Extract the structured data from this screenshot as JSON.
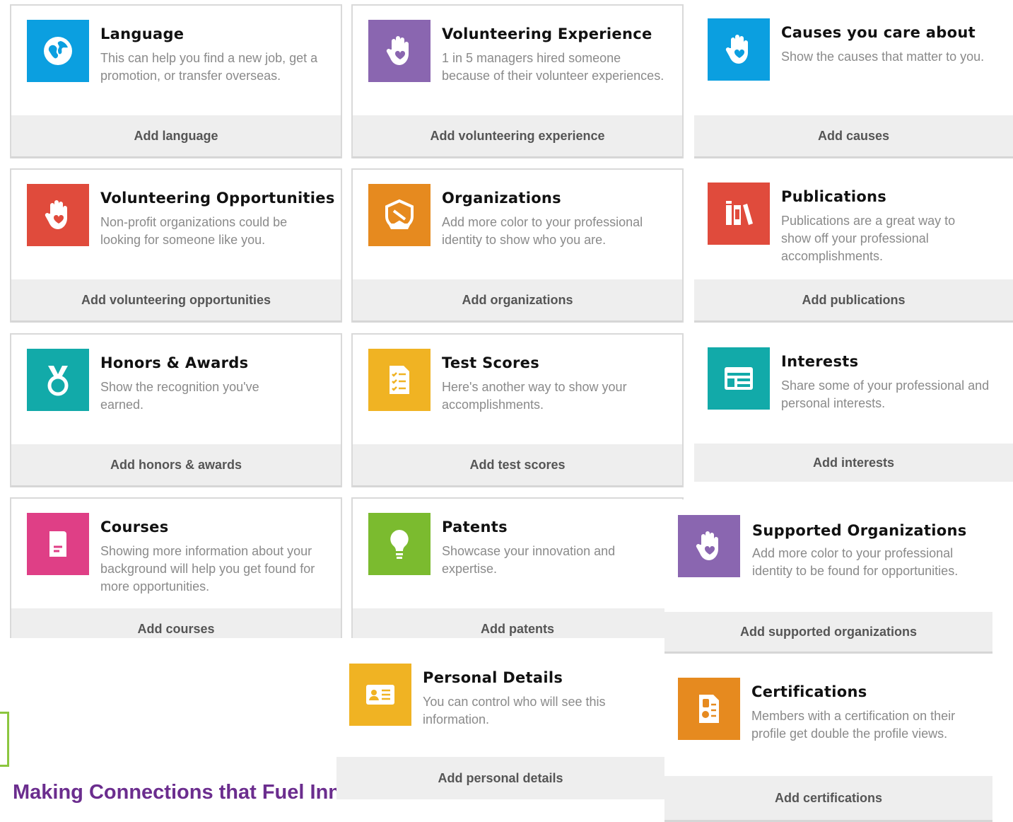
{
  "colors": {
    "blue": "#0b9fe0",
    "purple": "#8a66b0",
    "red": "#e04b3c",
    "orange": "#e68a1f",
    "teal": "#12aaa9",
    "yellow": "#f0b323",
    "pink": "#df3f86",
    "green": "#7bbb2f",
    "footer": "#6b2d8e"
  },
  "cards": {
    "language": {
      "title": "Language",
      "desc": "This can help you find a new job, get a promotion, or transfer overseas.",
      "action": "Add language",
      "icon": "globe-icon"
    },
    "volunteering_experience": {
      "title": "Volunteering Experience",
      "desc": "1 in 5 managers hired someone because of their volunteer experiences.",
      "action": "Add volunteering experience",
      "icon": "heart-hand-icon"
    },
    "causes": {
      "title": "Causes you care about",
      "desc": "Show the causes that matter to you.",
      "action": "Add causes",
      "icon": "heart-hand-icon"
    },
    "volunteering_opportunities": {
      "title": "Volunteering Opportunities",
      "desc": "Non-profit organizations could be looking for someone like you.",
      "action": "Add volunteering opportunities",
      "icon": "heart-hand-icon"
    },
    "organizations": {
      "title": "Organizations",
      "desc": "Add more color to your professional identity to show who you are.",
      "action": "Add organizations",
      "icon": "badge-icon"
    },
    "publications": {
      "title": "Publications",
      "desc": "Publications are a great way to show off your professional accomplishments.",
      "action": "Add publications",
      "icon": "books-icon"
    },
    "honors": {
      "title": "Honors & Awards",
      "desc": "Show the recognition you've earned.",
      "action": "Add honors & awards",
      "icon": "medal-icon"
    },
    "test_scores": {
      "title": "Test Scores",
      "desc": "Here's another way to show your accomplishments.",
      "action": "Add test scores",
      "icon": "checklist-icon"
    },
    "interests": {
      "title": "Interests",
      "desc": "Share some of your professional and personal interests.",
      "action": "Add interests",
      "icon": "browser-icon"
    },
    "courses": {
      "title": "Courses",
      "desc": "Showing more information about your background will help you get found for more opportunities.",
      "action": "Add courses",
      "icon": "book-icon"
    },
    "patents": {
      "title": "Patents",
      "desc": "Showcase your innovation and expertise.",
      "action": "Add patents",
      "icon": "lightbulb-icon"
    },
    "supported_orgs": {
      "title": "Supported Organizations",
      "desc": "Add more color to your professional identity to be found for opportunities.",
      "action": "Add supported organizations",
      "icon": "heart-hand-icon"
    },
    "personal_details": {
      "title": "Personal Details",
      "desc": "You can control who will see this information.",
      "action": "Add personal details",
      "icon": "id-card-icon"
    },
    "certifications": {
      "title": "Certifications",
      "desc": "Members with a certification on their profile get double the profile views.",
      "action": "Add certifications",
      "icon": "certificate-icon"
    }
  },
  "footer": {
    "text": "Making Connections that Fuel Innovation!"
  }
}
